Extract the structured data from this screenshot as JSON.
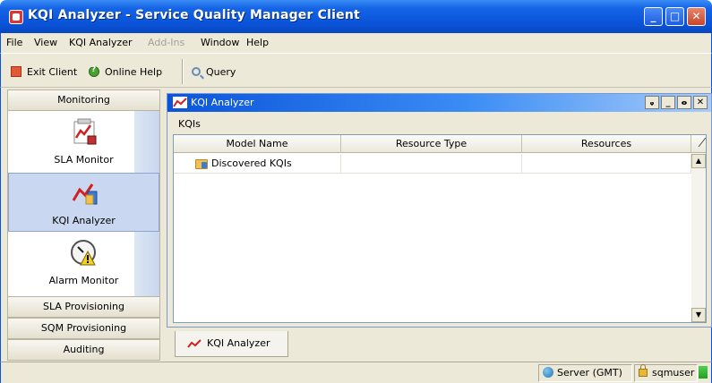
{
  "window": {
    "title": "KQI Analyzer - Service Quality Manager Client",
    "controls": [
      "minimize",
      "maximize",
      "close"
    ]
  },
  "menubar": {
    "items": [
      {
        "label": "File",
        "enabled": true
      },
      {
        "label": "View",
        "enabled": true
      },
      {
        "label": "KQI Analyzer",
        "enabled": true
      },
      {
        "label": "Add-Ins",
        "enabled": false
      },
      {
        "label": "Window",
        "enabled": true
      },
      {
        "label": "Help",
        "enabled": true
      }
    ]
  },
  "toolbar": {
    "exit_label": "Exit Client",
    "help_label": "Online Help",
    "query_label": "Query"
  },
  "nav": {
    "monitoring_header": "Monitoring",
    "entries": [
      {
        "label": "SLA Monitor",
        "icon": "sla-monitor-icon",
        "selected": false
      },
      {
        "label": "KQI Analyzer",
        "icon": "kqi-analyzer-icon",
        "selected": true
      },
      {
        "label": "Alarm Monitor",
        "icon": "alarm-monitor-icon",
        "selected": false
      }
    ],
    "sections": [
      "SLA Provisioning",
      "SQM Provisioning",
      "Auditing"
    ]
  },
  "inner_window": {
    "title": "KQI Analyzer",
    "controls": [
      "pin",
      "minimize",
      "restore",
      "close"
    ]
  },
  "kqis": {
    "label": "KQIs",
    "columns": [
      "Model Name",
      "Resource Type",
      "Resources"
    ],
    "rows": [
      {
        "model_name": "Discovered KQIs",
        "resource_type": "",
        "resources": ""
      }
    ]
  },
  "bottom_tab": {
    "label": "KQI Analyzer"
  },
  "statusbar": {
    "server": "Server (GMT)",
    "user": "sqmuser"
  },
  "colors": {
    "titlebar": "#0a54da",
    "chrome": "#ece9d8",
    "selection": "#c9d7f0"
  }
}
